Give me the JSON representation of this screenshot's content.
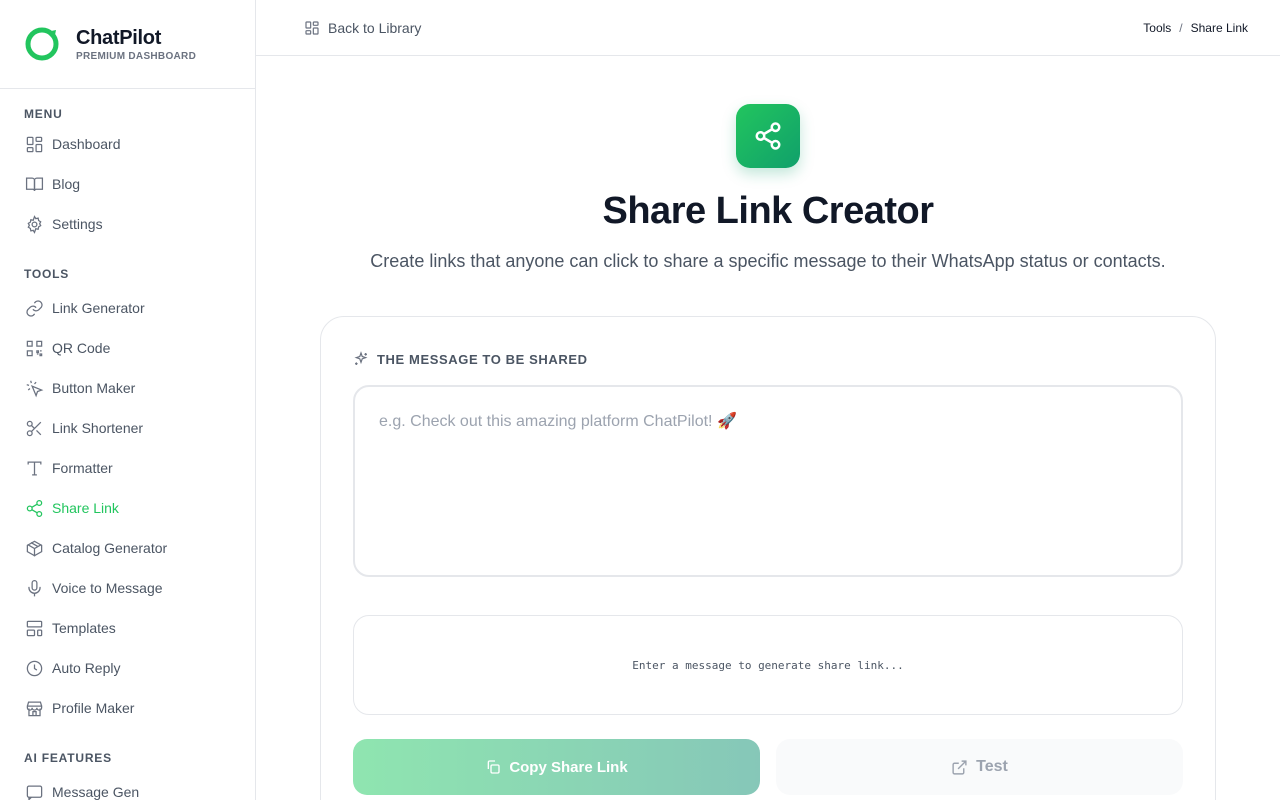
{
  "brand": {
    "name": "ChatPilot",
    "subtitle": "PREMIUM DASHBOARD",
    "accent": "#22c55e"
  },
  "sidebar": {
    "menu_title": "MENU",
    "menu_items": [
      {
        "label": "Dashboard",
        "icon": "grid-icon"
      },
      {
        "label": "Blog",
        "icon": "book-icon"
      },
      {
        "label": "Settings",
        "icon": "gear-icon"
      }
    ],
    "tools_title": "TOOLS",
    "tool_items": [
      {
        "label": "Link Generator",
        "icon": "link-icon"
      },
      {
        "label": "QR Code",
        "icon": "qr-icon"
      },
      {
        "label": "Button Maker",
        "icon": "cursor-click-icon"
      },
      {
        "label": "Link Shortener",
        "icon": "scissors-icon"
      },
      {
        "label": "Formatter",
        "icon": "type-icon"
      },
      {
        "label": "Share Link",
        "icon": "share-icon",
        "active": true
      },
      {
        "label": "Catalog Generator",
        "icon": "box-icon"
      },
      {
        "label": "Voice to Message",
        "icon": "mic-icon"
      },
      {
        "label": "Templates",
        "icon": "layout-icon"
      },
      {
        "label": "Auto Reply",
        "icon": "clock-icon"
      },
      {
        "label": "Profile Maker",
        "icon": "store-icon"
      }
    ],
    "ai_title": "AI FEATURES",
    "ai_items": [
      {
        "label": "Message Gen",
        "icon": "message-icon"
      }
    ]
  },
  "topbar": {
    "back_label": "Back to Library",
    "breadcrumb": [
      "Tools",
      "Share Link"
    ],
    "breadcrumb_sep": "/"
  },
  "main": {
    "title": "Share Link Creator",
    "subtitle": "Create links that anyone can click to share a specific message to their WhatsApp status or contacts.",
    "message_label": "THE MESSAGE TO BE SHARED",
    "message_value": "",
    "message_placeholder": "e.g. Check out this amazing platform ChatPilot! 🚀",
    "preview_text": "Enter a message to generate share link...",
    "copy_button": "Copy Share Link",
    "test_button": "Test"
  }
}
